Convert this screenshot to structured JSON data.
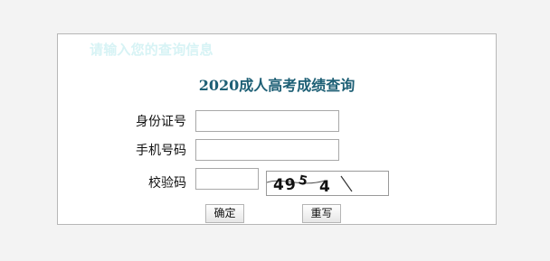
{
  "panel": {
    "hint": "请输入您的查询信息"
  },
  "form": {
    "title": "2020成人高考成绩查询",
    "fields": {
      "id_card": {
        "label": "身份证号",
        "value": ""
      },
      "phone": {
        "label": "手机号码",
        "value": ""
      },
      "captcha": {
        "label": "校验码",
        "value": "",
        "image_text": "4954"
      }
    },
    "buttons": {
      "confirm": "确定",
      "reset": "重写"
    }
  }
}
